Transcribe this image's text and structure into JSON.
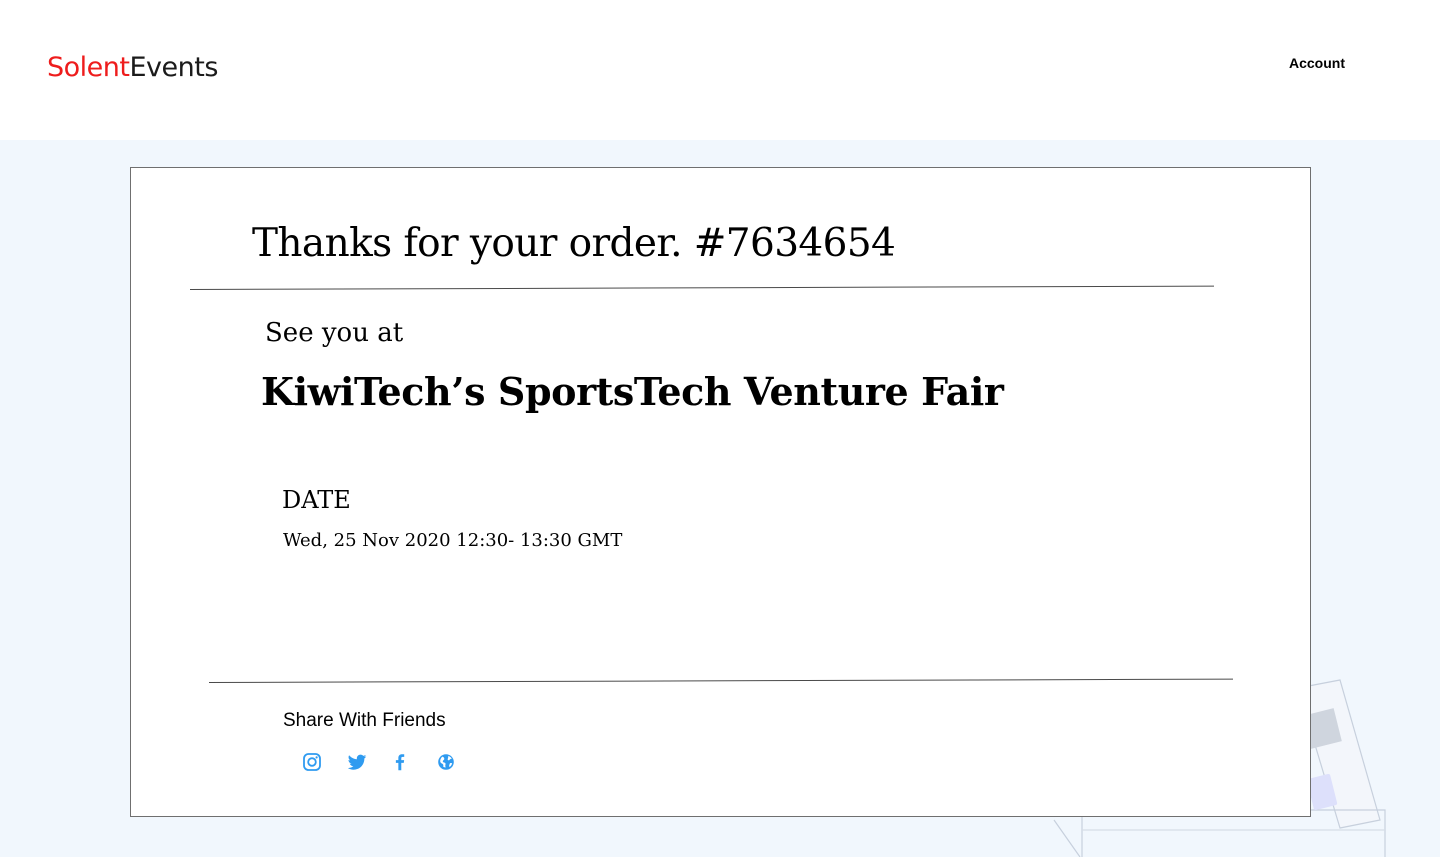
{
  "header": {
    "logo_brand": "Solent",
    "logo_suffix": "Events",
    "account_label": "Account"
  },
  "confirmation": {
    "title": "Thanks for your order. #7634654",
    "see_you_at": "See you at",
    "event_name": "KiwiTech’s SportsTech Venture Fair",
    "date_label": "DATE",
    "date_value": "Wed, 25 Nov 2020 12:30- 13:30 GMT"
  },
  "share": {
    "label": "Share With Friends",
    "icons": [
      "instagram-icon",
      "twitter-icon",
      "facebook-icon",
      "globe-icon"
    ]
  },
  "colors": {
    "brand_red": "#ee1c1c",
    "social_blue": "#2f9bf0",
    "page_background": "#f1f7fd"
  }
}
